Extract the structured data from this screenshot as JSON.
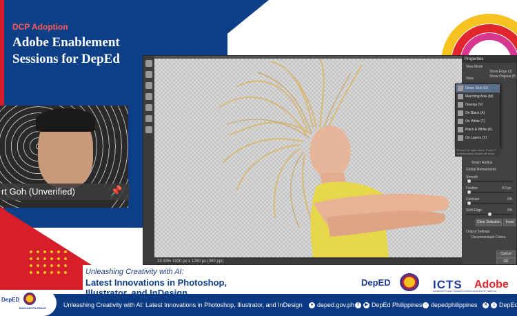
{
  "header": {
    "program": "DCP Adoption",
    "title_line1": "Adobe Enablement",
    "title_line2": "Sessions for DepEd"
  },
  "participant": {
    "name": "rt Goh (Unverified)"
  },
  "photoshop": {
    "panel_title": "Properties",
    "view_mode_label": "View Mode",
    "show_edge": "Show Edge (J)",
    "show_original": "Show Original (P)",
    "view_label": "View",
    "view_options": [
      "Onion Skin (O)",
      "Marching Ants (M)",
      "Overlay (V)",
      "On Black (A)",
      "On White (T)",
      "Black & White (K)",
      "On Layers (Y)"
    ],
    "view_note": "Press F to cycle views. Press X to temporarily disable all views.",
    "smart_radius": "Smart Radius",
    "global_refinements": "Global Refinements",
    "smooth_label": "Smooth",
    "feather_label": "Feather",
    "feather_value": "0.0 px",
    "contrast_label": "Contrast",
    "contrast_value": "0%",
    "shift_edge_label": "Shift Edge",
    "shift_edge_value": "0%",
    "clear_selection": "Clear Selection",
    "invert": "Invert",
    "output_settings": "Output Settings",
    "decontaminate": "Decontaminate Colors",
    "cancel": "Cancel",
    "ok": "OK",
    "status": "33.33%   1920 px x 1280 px (300 ppi)"
  },
  "session": {
    "subtitle": "Unleashing Creativity with AI:",
    "title": "Latest Innovations in Photoshop, Illustrator, and InDesign"
  },
  "logos": {
    "deped": "DepED",
    "icts": "ICTS",
    "icts_sub": "INFORMATION AND COMMUNICATIONS TECHNOLOGY SERVICE",
    "adobe": "Adobe",
    "bagong_pilipinas": "BAGONG PILIPINAS"
  },
  "ticker": {
    "text": "Unleashing Creativity with AI: Latest Innovations in Photoshop, Illustrator, and InDesign",
    "website": "deped.gov.ph",
    "facebook_youtube": "DepEd Philippines",
    "instagram": "depedphilippines",
    "x_tiktok": "DepEd_P"
  },
  "colors": {
    "deped_blue": "#0d3f86",
    "deped_red": "#d61f2a",
    "accent_yellow": "#f6c220",
    "hair_blonde": "#d8b878",
    "top_yellow": "#e6d84a"
  }
}
